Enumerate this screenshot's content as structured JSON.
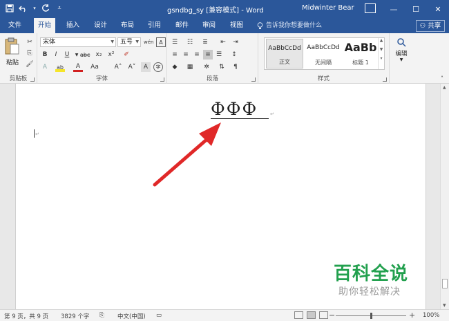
{
  "titlebar": {
    "doc_title": "gsndbg_sy [兼容模式] - Word",
    "user": "Midwinter Bear",
    "save_icon": "save-icon",
    "undo_icon": "undo-icon",
    "redo_icon": "redo-icon",
    "minimize": "—",
    "maximize": "☐",
    "close": "✕"
  },
  "tabs": [
    "文件",
    "开始",
    "插入",
    "设计",
    "布局",
    "引用",
    "邮件",
    "审阅",
    "视图"
  ],
  "active_tab": "开始",
  "tellme": "告诉我你想要做什么",
  "share": "共享",
  "ribbon": {
    "clipboard": {
      "paste": "粘贴",
      "label": "剪贴板"
    },
    "font": {
      "font_name": "宋体",
      "font_size": "五号",
      "bold": "B",
      "italic": "I",
      "underline": "U",
      "strike": "abc",
      "subscript": "x₂",
      "superscript": "x²",
      "text_effects": "A",
      "highlight": "ab",
      "font_color": "A",
      "change_case": "Aa",
      "grow": "A˄",
      "shrink": "A˅",
      "clear": "A",
      "phonetic": "wén",
      "border_char": "A",
      "enclose": "字",
      "label": "字体"
    },
    "paragraph": {
      "label": "段落"
    },
    "styles": {
      "items": [
        {
          "preview": "AaBbCcDd",
          "name": "正文"
        },
        {
          "preview": "AaBbCcDd",
          "name": "无间隔"
        },
        {
          "preview": "AaBb",
          "name": "标题 1"
        }
      ],
      "label": "样式"
    },
    "editing": {
      "label": "编辑"
    }
  },
  "document": {
    "symbols": "ФФФ",
    "para_mark": "↵"
  },
  "watermark": {
    "title": "百科全说",
    "subtitle": "助你轻松解决"
  },
  "statusbar": {
    "page": "第 9 页，共 9 页",
    "words": "3829 个字",
    "language": "中文(中国)",
    "zoom": "100%",
    "zoom_minus": "−",
    "zoom_plus": "+"
  },
  "colors": {
    "title_blue": "#2b579a",
    "arrow_red": "#e02828",
    "watermark_green": "#22a04e"
  }
}
